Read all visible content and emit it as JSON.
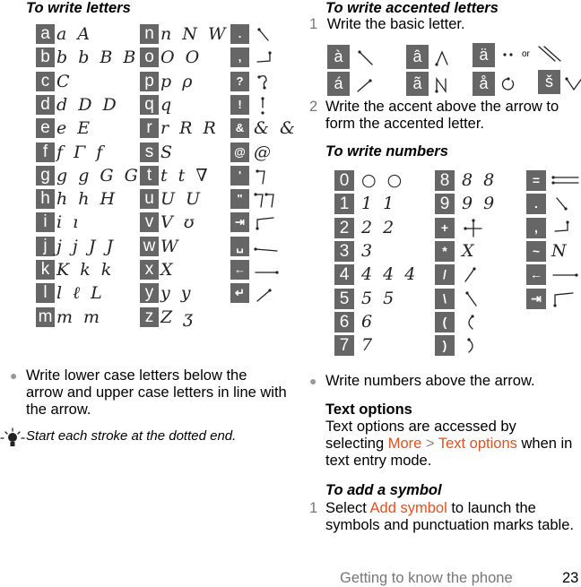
{
  "letters": {
    "heading": "To write letters",
    "rows_col1": [
      {
        "key": "a",
        "strokes": "a A"
      },
      {
        "key": "b",
        "strokes": "b b B B"
      },
      {
        "key": "c",
        "strokes": "C"
      },
      {
        "key": "d",
        "strokes": "d D D"
      },
      {
        "key": "e",
        "strokes": "e E"
      },
      {
        "key": "f",
        "strokes": "f Γ f"
      },
      {
        "key": "g",
        "strokes": "g g G G"
      },
      {
        "key": "h",
        "strokes": "h h H"
      },
      {
        "key": "i",
        "strokes": "i ı"
      },
      {
        "key": "j",
        "strokes": "j j J J"
      },
      {
        "key": "k",
        "strokes": "K k k"
      },
      {
        "key": "l",
        "strokes": "l ℓ L"
      },
      {
        "key": "m",
        "strokes": "m m"
      }
    ],
    "rows_col2": [
      {
        "key": "n",
        "strokes": "n N W"
      },
      {
        "key": "o",
        "strokes": "O O"
      },
      {
        "key": "p",
        "strokes": "p ρ"
      },
      {
        "key": "q",
        "strokes": "q"
      },
      {
        "key": "r",
        "strokes": "r R R"
      },
      {
        "key": "s",
        "strokes": "S"
      },
      {
        "key": "t",
        "strokes": "t t ∇"
      },
      {
        "key": "u",
        "strokes": "U U"
      },
      {
        "key": "v",
        "strokes": "V ʊ"
      },
      {
        "key": "w",
        "strokes": "W"
      },
      {
        "key": "x",
        "strokes": "X"
      },
      {
        "key": "y",
        "strokes": "y y"
      },
      {
        "key": "z",
        "strokes": "Z ʒ"
      }
    ],
    "rows_col3": [
      {
        "key": ".",
        "name": "period"
      },
      {
        "key": ",",
        "name": "comma"
      },
      {
        "key": "?",
        "name": "question"
      },
      {
        "key": "!",
        "name": "exclamation"
      },
      {
        "key": "&",
        "name": "ampersand",
        "strokes": "& &"
      },
      {
        "key": "@",
        "name": "at",
        "strokes": "@"
      },
      {
        "key": "'",
        "name": "apostrophe"
      },
      {
        "key": "\"",
        "name": "quote"
      },
      {
        "key": "⇥",
        "name": "tab"
      },
      {
        "key": "␣",
        "name": "space"
      },
      {
        "key": "←",
        "name": "backspace"
      },
      {
        "key": "↵",
        "name": "enter"
      }
    ],
    "bullet": "Write lower case letters below the arrow and upper case letters in line with the arrow.",
    "tip": "Start each stroke at the dotted end."
  },
  "accented": {
    "heading": "To write accented letters",
    "step1_num": "1",
    "step1": "Write the basic letter.",
    "keys": [
      {
        "key": "à"
      },
      {
        "key": "â"
      },
      {
        "key": "ä",
        "or": "or"
      },
      {
        "key": "á"
      },
      {
        "key": "ã"
      },
      {
        "key": "å"
      },
      {
        "key": "š"
      }
    ],
    "step2_num": "2",
    "step2": "Write the accent above the arrow to form the accented letter."
  },
  "numbers": {
    "heading": "To write numbers",
    "col1": [
      {
        "key": "0",
        "strokes": "○ ○"
      },
      {
        "key": "1",
        "strokes": "1 1"
      },
      {
        "key": "2",
        "strokes": "2 2"
      },
      {
        "key": "3",
        "strokes": "3"
      },
      {
        "key": "4",
        "strokes": "4 4 4"
      },
      {
        "key": "5",
        "strokes": "5 5"
      },
      {
        "key": "6",
        "strokes": "6"
      },
      {
        "key": "7",
        "strokes": "7"
      }
    ],
    "col2": [
      {
        "key": "8",
        "strokes": "8 8"
      },
      {
        "key": "9",
        "strokes": "9 9"
      },
      {
        "key": "+"
      },
      {
        "key": "*",
        "strokes": "X"
      },
      {
        "key": "/"
      },
      {
        "key": "\\"
      },
      {
        "key": "("
      },
      {
        "key": ")"
      }
    ],
    "col3": [
      {
        "key": "="
      },
      {
        "key": "."
      },
      {
        "key": ","
      },
      {
        "key": "~",
        "strokes": "N"
      },
      {
        "key": "←"
      },
      {
        "key": "⇥"
      }
    ],
    "bullet": "Write numbers above the arrow."
  },
  "text_options": {
    "heading": "Text options",
    "line_pre": "Text options are accessed by selecting ",
    "link_more": "More",
    "sep": " > ",
    "link_text_options": "Text options",
    "line_post": " when in text entry mode."
  },
  "add_symbol": {
    "heading": "To add a symbol",
    "step_num": "1",
    "pre": "Select ",
    "link": "Add symbol",
    "post": " to launch the symbols and punctuation marks table."
  },
  "footer": {
    "section": "Getting to know the phone",
    "page": "23"
  },
  "colors": {
    "box": "#666666",
    "link": "#e8501e",
    "muted": "#777777"
  }
}
